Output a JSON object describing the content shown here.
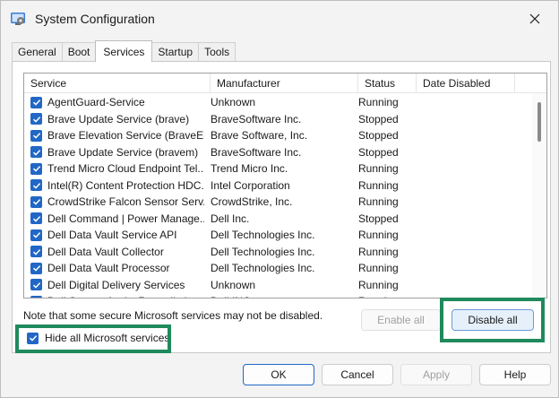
{
  "window": {
    "title": "System Configuration",
    "icon": "system-config-icon"
  },
  "tabs": [
    {
      "label": "General",
      "active": false
    },
    {
      "label": "Boot",
      "active": false
    },
    {
      "label": "Services",
      "active": true
    },
    {
      "label": "Startup",
      "active": false
    },
    {
      "label": "Tools",
      "active": false
    }
  ],
  "list": {
    "columns": [
      "Service",
      "Manufacturer",
      "Status",
      "Date Disabled"
    ],
    "rows": [
      {
        "service": "AgentGuard-Service",
        "manufacturer": "Unknown",
        "status": "Running",
        "date": "",
        "checked": true
      },
      {
        "service": "Brave Update Service (brave)",
        "manufacturer": "BraveSoftware Inc.",
        "status": "Stopped",
        "date": "",
        "checked": true
      },
      {
        "service": "Brave Elevation Service (BraveEl...",
        "manufacturer": "Brave Software, Inc.",
        "status": "Stopped",
        "date": "",
        "checked": true
      },
      {
        "service": "Brave Update Service (bravem)",
        "manufacturer": "BraveSoftware Inc.",
        "status": "Stopped",
        "date": "",
        "checked": true
      },
      {
        "service": "Trend Micro Cloud Endpoint Tel...",
        "manufacturer": "Trend Micro Inc.",
        "status": "Running",
        "date": "",
        "checked": true
      },
      {
        "service": "Intel(R) Content Protection HDC...",
        "manufacturer": "Intel Corporation",
        "status": "Running",
        "date": "",
        "checked": true
      },
      {
        "service": "CrowdStrike Falcon Sensor Serv...",
        "manufacturer": "CrowdStrike, Inc.",
        "status": "Running",
        "date": "",
        "checked": true
      },
      {
        "service": "Dell Command | Power Manage...",
        "manufacturer": "Dell Inc.",
        "status": "Stopped",
        "date": "",
        "checked": true
      },
      {
        "service": "Dell Data Vault Service API",
        "manufacturer": "Dell Technologies Inc.",
        "status": "Running",
        "date": "",
        "checked": true
      },
      {
        "service": "Dell Data Vault Collector",
        "manufacturer": "Dell Technologies Inc.",
        "status": "Running",
        "date": "",
        "checked": true
      },
      {
        "service": "Dell Data Vault Processor",
        "manufacturer": "Dell Technologies Inc.",
        "status": "Running",
        "date": "",
        "checked": true
      },
      {
        "service": "Dell Digital Delivery Services",
        "manufacturer": "Unknown",
        "status": "Running",
        "date": "",
        "checked": true
      },
      {
        "service": "Dell SupportAssist Remediation",
        "manufacturer": "Dell INC.",
        "status": "Running",
        "date": "",
        "checked": true
      }
    ]
  },
  "note": "Note that some secure Microsoft services may not be disabled.",
  "buttons": {
    "enable_all": "Enable all",
    "disable_all": "Disable all",
    "ok": "OK",
    "cancel": "Cancel",
    "apply": "Apply",
    "help": "Help"
  },
  "hide_ms": {
    "label": "Hide all Microsoft services",
    "checked": true
  },
  "colors": {
    "accent": "#2167c6",
    "highlight_box": "#1f8a5c"
  }
}
